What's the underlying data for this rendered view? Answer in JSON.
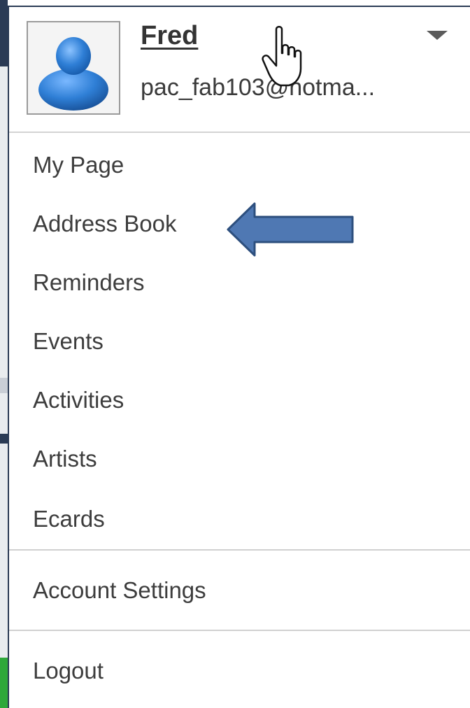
{
  "user": {
    "name": "Fred",
    "email": "pac_fab103@hotma..."
  },
  "menu": {
    "items": [
      {
        "id": "my-page",
        "label": "My Page"
      },
      {
        "id": "address-book",
        "label": "Address Book"
      },
      {
        "id": "reminders",
        "label": "Reminders"
      },
      {
        "id": "events",
        "label": "Events"
      },
      {
        "id": "activities",
        "label": "Activities"
      },
      {
        "id": "artists",
        "label": "Artists"
      },
      {
        "id": "ecards",
        "label": "Ecards"
      }
    ],
    "account_settings": "Account Settings",
    "logout": "Logout"
  },
  "icons": {
    "avatar": "person-silhouette-icon",
    "dropdown": "caret-down-icon",
    "cursor": "hand-pointer-icon",
    "annotation": "left-arrow-icon"
  },
  "colors": {
    "avatar_blue": "#2f7fd6",
    "arrow_fill": "#4f78b3",
    "arrow_stroke": "#2d4f7e",
    "panel_border": "#2b3b55"
  }
}
